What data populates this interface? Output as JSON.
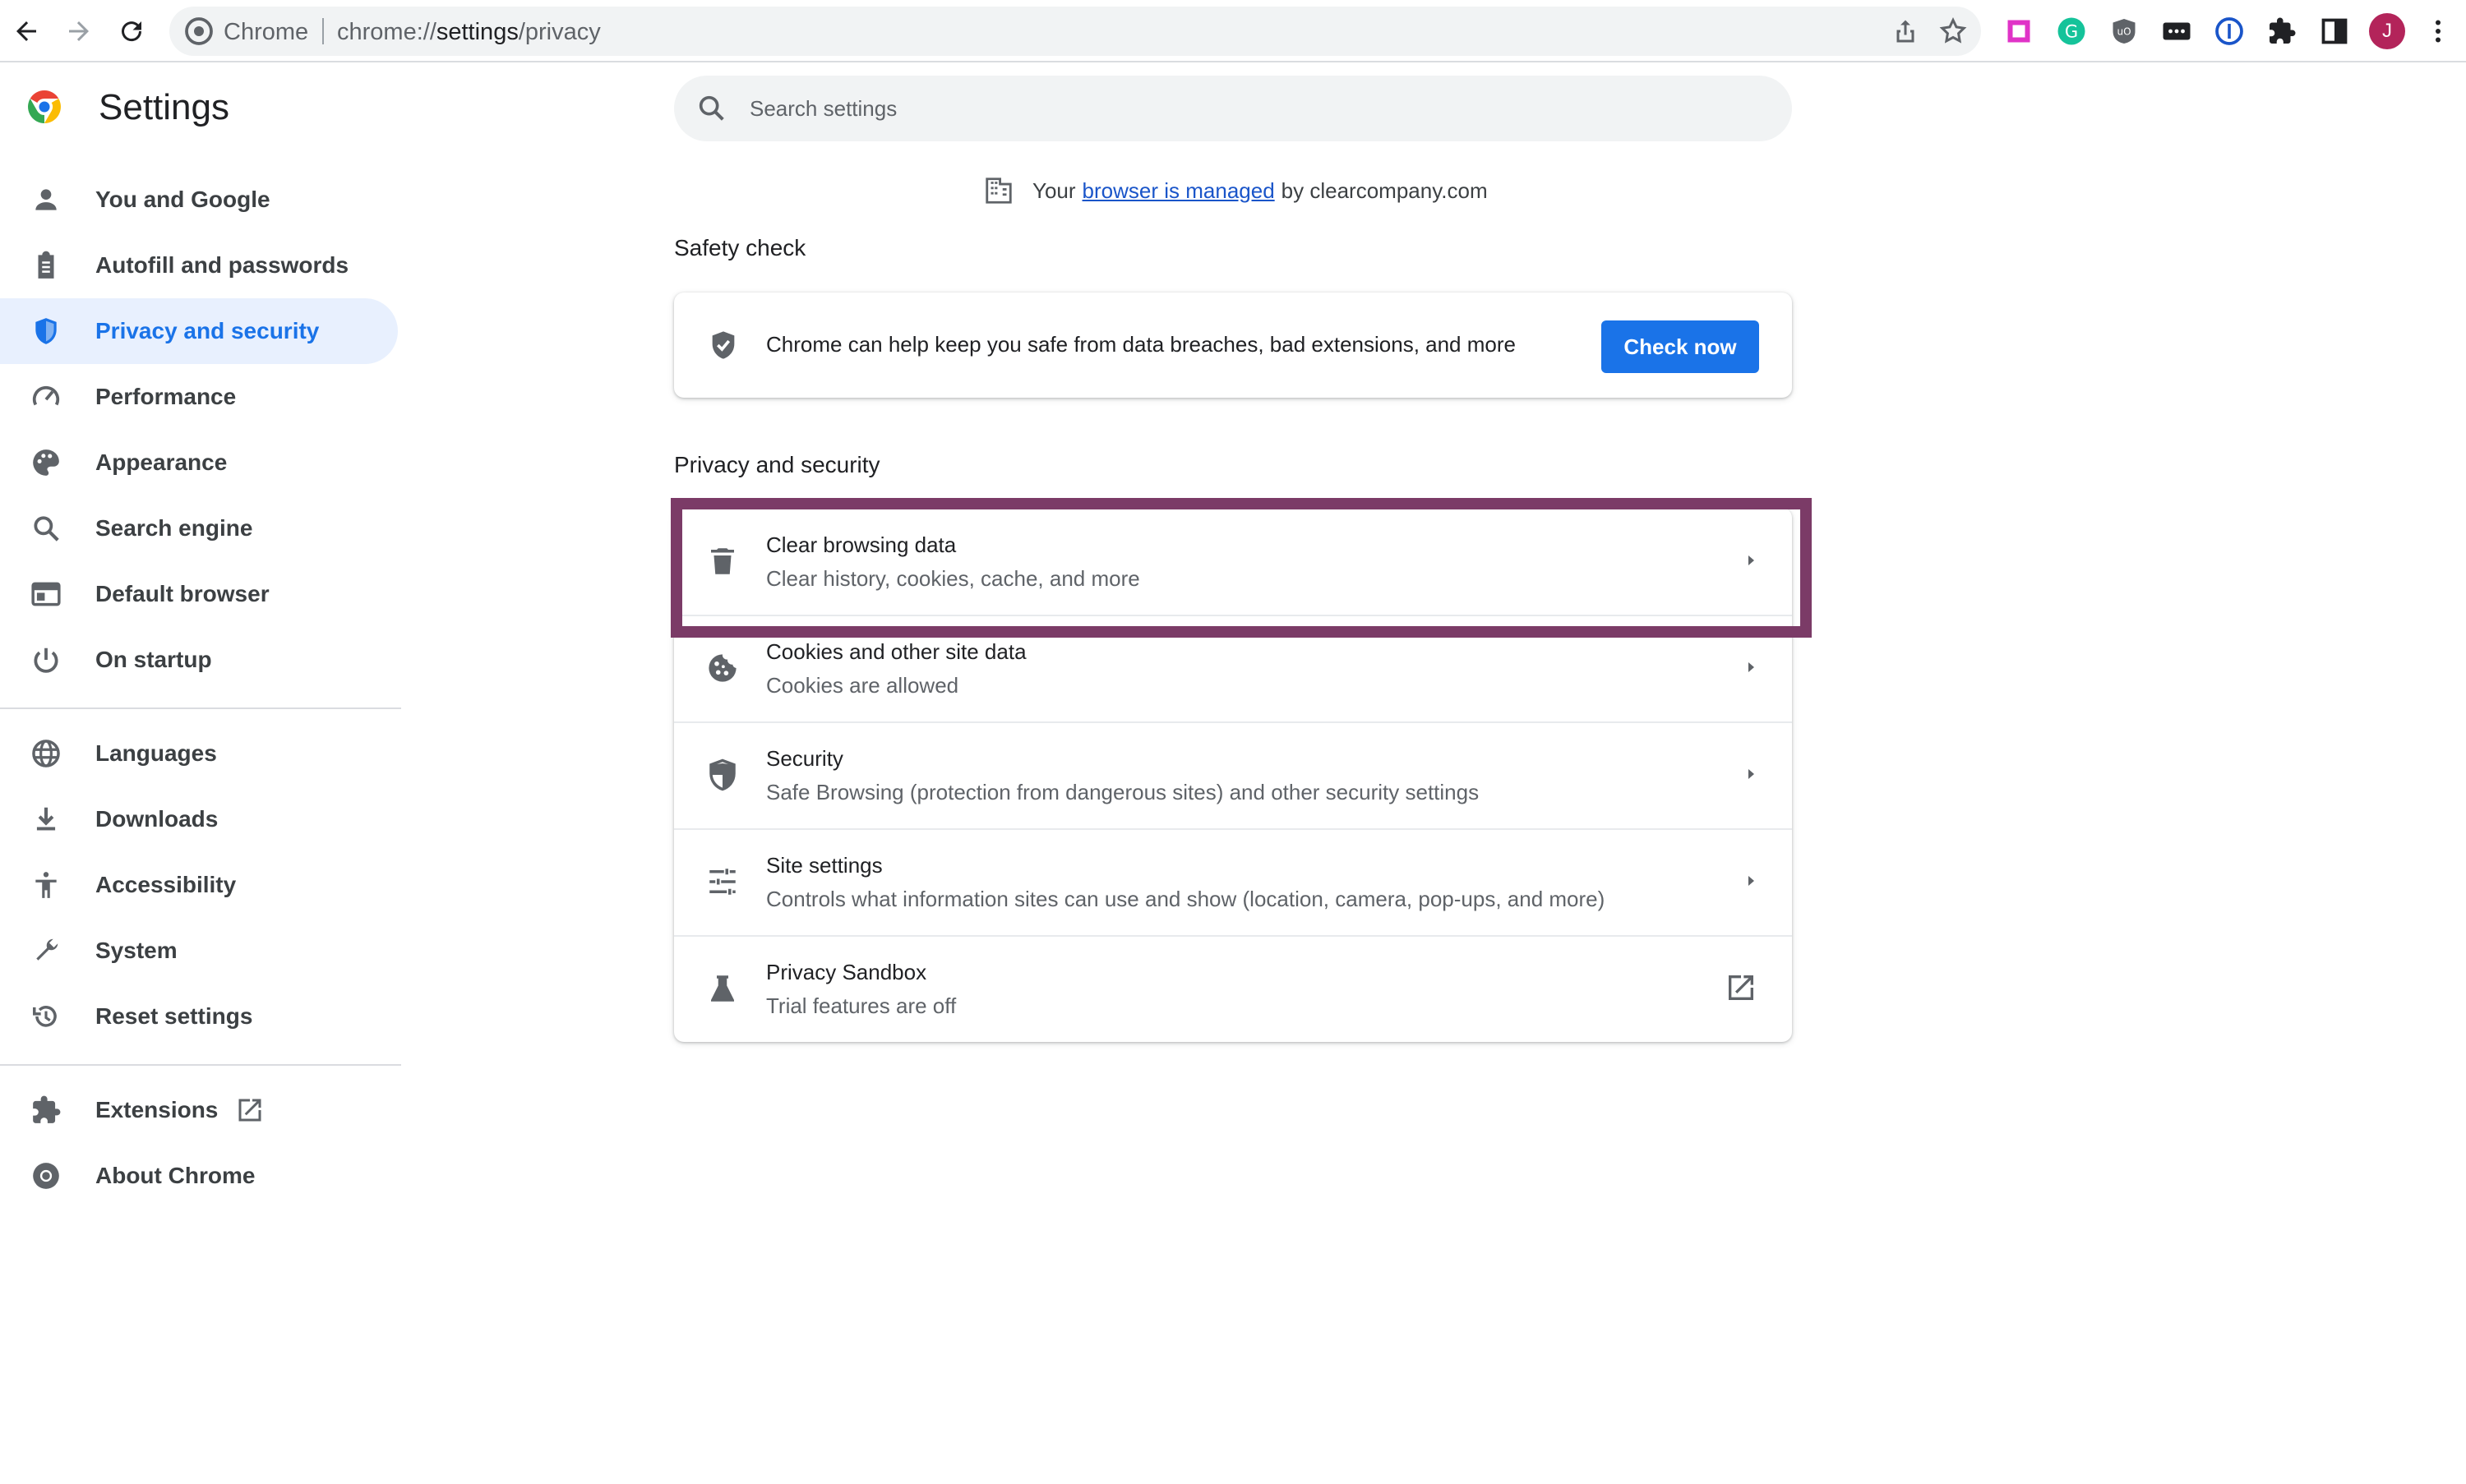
{
  "browser": {
    "omnibox_site": "Chrome",
    "omnibox_url_prefix": "chrome://",
    "omnibox_url_host": "settings",
    "omnibox_url_path": "/privacy",
    "avatar_initial": "J"
  },
  "sidebar": {
    "title": "Settings",
    "items": [
      {
        "label": "You and Google",
        "icon": "person-icon"
      },
      {
        "label": "Autofill and passwords",
        "icon": "clipboard-icon"
      },
      {
        "label": "Privacy and security",
        "icon": "shield-icon",
        "active": true
      },
      {
        "label": "Performance",
        "icon": "speedometer-icon"
      },
      {
        "label": "Appearance",
        "icon": "palette-icon"
      },
      {
        "label": "Search engine",
        "icon": "search-icon"
      },
      {
        "label": "Default browser",
        "icon": "browser-window-icon"
      },
      {
        "label": "On startup",
        "icon": "power-icon"
      },
      {
        "label": "Languages",
        "icon": "globe-icon"
      },
      {
        "label": "Downloads",
        "icon": "download-icon"
      },
      {
        "label": "Accessibility",
        "icon": "accessibility-icon"
      },
      {
        "label": "System",
        "icon": "wrench-icon"
      },
      {
        "label": "Reset settings",
        "icon": "history-icon"
      },
      {
        "label": "Extensions",
        "icon": "puzzle-icon"
      },
      {
        "label": "About Chrome",
        "icon": "chrome-icon"
      }
    ]
  },
  "search": {
    "placeholder": "Search settings"
  },
  "managed": {
    "prefix": "Your",
    "link": "browser is managed",
    "suffix": "by clearcompany.com"
  },
  "safety_check": {
    "title": "Safety check",
    "text": "Chrome can help keep you safe from data breaches, bad extensions, and more",
    "button": "Check now"
  },
  "privacy": {
    "title": "Privacy and security",
    "rows": [
      {
        "title": "Clear browsing data",
        "subtitle": "Clear history, cookies, cache, and more"
      },
      {
        "title": "Cookies and other site data",
        "subtitle": "Cookies are allowed"
      },
      {
        "title": "Security",
        "subtitle": "Safe Browsing (protection from dangerous sites) and other security settings"
      },
      {
        "title": "Site settings",
        "subtitle": "Controls what information sites can use and show (location, camera, pop-ups, and more)"
      },
      {
        "title": "Privacy Sandbox",
        "subtitle": "Trial features are off"
      }
    ]
  },
  "colors": {
    "accent": "#1a73e8",
    "highlight_border": "#7b3b67",
    "active_bg": "#e8f0fe"
  }
}
